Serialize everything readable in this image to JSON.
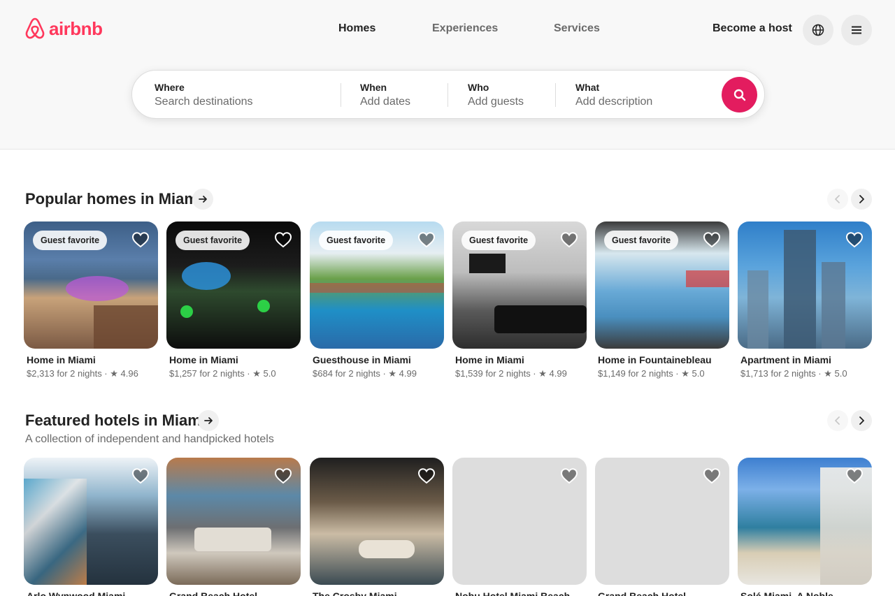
{
  "header": {
    "logo_text": "airbnb",
    "brand_color": "#ff385c",
    "tabs": [
      {
        "label": "Homes",
        "active": true
      },
      {
        "label": "Experiences",
        "active": false
      },
      {
        "label": "Services",
        "active": false
      }
    ],
    "host_link": "Become a host",
    "globe_icon": "globe-icon",
    "menu_icon": "menu-icon"
  },
  "search": {
    "where": {
      "label": "Where",
      "placeholder": "Search destinations"
    },
    "when": {
      "label": "When",
      "placeholder": "Add dates"
    },
    "who": {
      "label": "Who",
      "placeholder": "Add guests"
    },
    "what": {
      "label": "What",
      "placeholder": "Add description"
    },
    "button_icon": "search-icon",
    "button_color": "#e31c5f"
  },
  "sections": [
    {
      "title": "Popular homes in Miami",
      "subtitle": "",
      "cards": [
        {
          "title": "Home in Miami",
          "meta": "$2,313 for 2 nights · ★ 4.96",
          "badge": "Guest favorite"
        },
        {
          "title": "Home in Miami",
          "meta": "$1,257 for 2 nights · ★ 5.0",
          "badge": "Guest favorite"
        },
        {
          "title": "Guesthouse in Miami",
          "meta": "$684 for 2 nights · ★ 4.99",
          "badge": "Guest favorite"
        },
        {
          "title": "Home in Miami",
          "meta": "$1,539 for 2 nights · ★ 4.99",
          "badge": "Guest favorite"
        },
        {
          "title": "Home in Fountainebleau",
          "meta": "$1,149 for 2 nights · ★ 5.0",
          "badge": "Guest favorite"
        },
        {
          "title": "Apartment in Miami",
          "meta": "$1,713 for 2 nights · ★ 5.0",
          "badge": ""
        }
      ]
    },
    {
      "title": "Featured hotels in Miami",
      "subtitle": "A collection of independent and handpicked hotels",
      "cards": [
        {
          "title": "Arlo Wynwood Miami",
          "meta": "",
          "badge": ""
        },
        {
          "title": "Grand Beach Hotel",
          "meta": "",
          "badge": ""
        },
        {
          "title": "The Crosby Miami",
          "meta": "",
          "badge": ""
        },
        {
          "title": "Nobu Hotel Miami Beach",
          "meta": "",
          "badge": ""
        },
        {
          "title": "Grand Beach Hotel",
          "meta": "",
          "badge": ""
        },
        {
          "title": "Solé Miami, A Noble",
          "meta": "",
          "badge": ""
        }
      ]
    }
  ]
}
